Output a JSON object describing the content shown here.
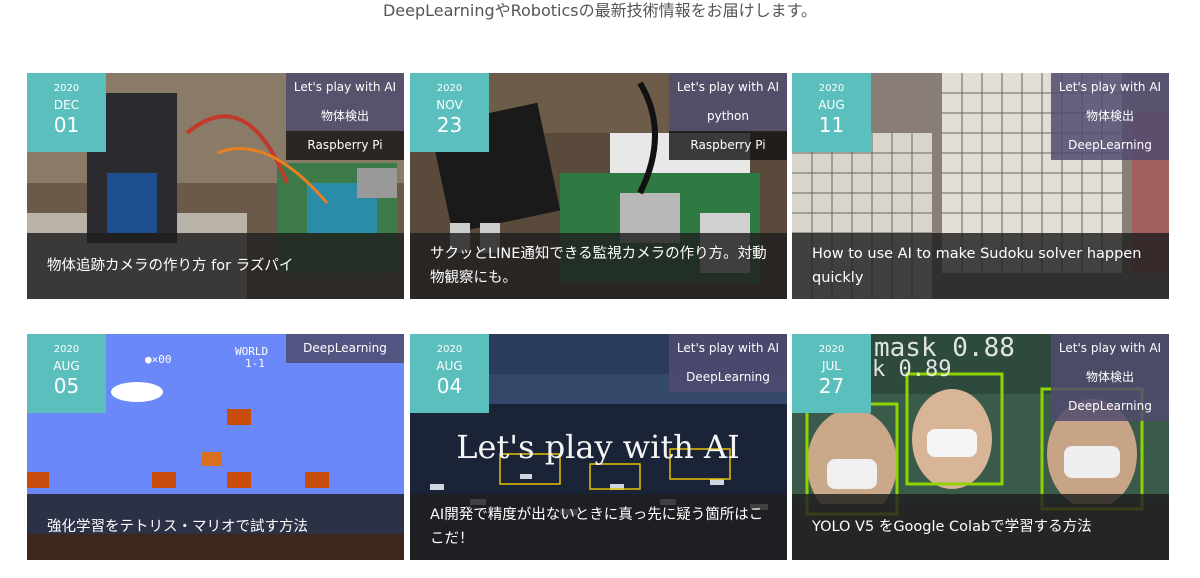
{
  "tagline": "DeepLearningやRoboticsの最新技術情報をお届けします。",
  "cards": [
    {
      "year": "2020",
      "month": "DEC",
      "day": "01",
      "tags": [
        "Let's play with AI",
        "物体検出",
        "Raspberry Pi"
      ],
      "title": "物体追跡カメラの作り方 for ラズパイ"
    },
    {
      "year": "2020",
      "month": "NOV",
      "day": "23",
      "tags": [
        "Let's play with AI",
        "python",
        "Raspberry Pi"
      ],
      "title": "サクッとLINE通知できる監視カメラの作り方。対動物観察にも。"
    },
    {
      "year": "2020",
      "month": "AUG",
      "day": "11",
      "tags": [
        "Let's play with AI",
        "物体検出",
        "DeepLearning"
      ],
      "title": "How to use AI to make Sudoku solver happen quickly"
    },
    {
      "year": "2020",
      "month": "AUG",
      "day": "05",
      "tags": [
        "DeepLearning"
      ],
      "title": "強化学習をテトリス・マリオで試す方法",
      "image_text": [
        "WORLD",
        "1-1",
        "●×00"
      ]
    },
    {
      "year": "2020",
      "month": "AUG",
      "day": "04",
      "tags": [
        "Let's play with AI",
        "DeepLearning"
      ],
      "title": "AI開発で精度が出ないときに真っ先に疑う箇所はここだ！",
      "image_text": [
        "Let's play with AI"
      ]
    },
    {
      "year": "2020",
      "month": "JUL",
      "day": "27",
      "tags": [
        "Let's play with AI",
        "物体検出",
        "DeepLearning"
      ],
      "title": "YOLO V5 をGoogle Colabで学習する方法",
      "image_text": [
        "mask 0.88",
        "k 0.89"
      ]
    }
  ],
  "colors": {
    "date_accent": "#5bbfbd",
    "tag_bg": "#504b6e",
    "overlay": "#1e1e1e"
  }
}
